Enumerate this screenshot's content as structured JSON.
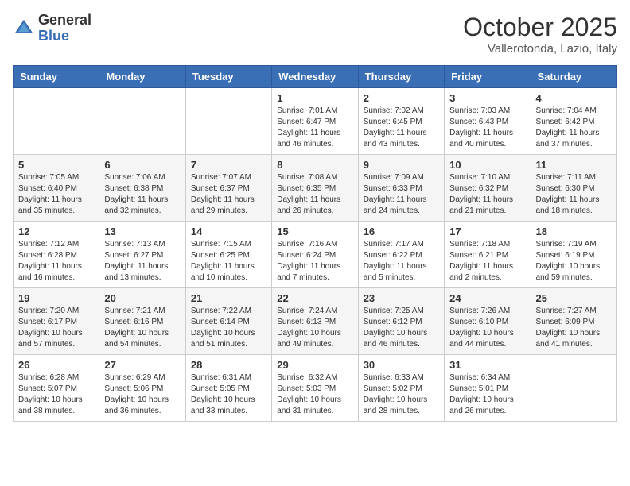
{
  "header": {
    "logo_general": "General",
    "logo_blue": "Blue",
    "month": "October 2025",
    "location": "Vallerotonda, Lazio, Italy"
  },
  "weekdays": [
    "Sunday",
    "Monday",
    "Tuesday",
    "Wednesday",
    "Thursday",
    "Friday",
    "Saturday"
  ],
  "weeks": [
    [
      {
        "day": "",
        "info": ""
      },
      {
        "day": "",
        "info": ""
      },
      {
        "day": "",
        "info": ""
      },
      {
        "day": "1",
        "info": "Sunrise: 7:01 AM\nSunset: 6:47 PM\nDaylight: 11 hours and 46 minutes."
      },
      {
        "day": "2",
        "info": "Sunrise: 7:02 AM\nSunset: 6:45 PM\nDaylight: 11 hours and 43 minutes."
      },
      {
        "day": "3",
        "info": "Sunrise: 7:03 AM\nSunset: 6:43 PM\nDaylight: 11 hours and 40 minutes."
      },
      {
        "day": "4",
        "info": "Sunrise: 7:04 AM\nSunset: 6:42 PM\nDaylight: 11 hours and 37 minutes."
      }
    ],
    [
      {
        "day": "5",
        "info": "Sunrise: 7:05 AM\nSunset: 6:40 PM\nDaylight: 11 hours and 35 minutes."
      },
      {
        "day": "6",
        "info": "Sunrise: 7:06 AM\nSunset: 6:38 PM\nDaylight: 11 hours and 32 minutes."
      },
      {
        "day": "7",
        "info": "Sunrise: 7:07 AM\nSunset: 6:37 PM\nDaylight: 11 hours and 29 minutes."
      },
      {
        "day": "8",
        "info": "Sunrise: 7:08 AM\nSunset: 6:35 PM\nDaylight: 11 hours and 26 minutes."
      },
      {
        "day": "9",
        "info": "Sunrise: 7:09 AM\nSunset: 6:33 PM\nDaylight: 11 hours and 24 minutes."
      },
      {
        "day": "10",
        "info": "Sunrise: 7:10 AM\nSunset: 6:32 PM\nDaylight: 11 hours and 21 minutes."
      },
      {
        "day": "11",
        "info": "Sunrise: 7:11 AM\nSunset: 6:30 PM\nDaylight: 11 hours and 18 minutes."
      }
    ],
    [
      {
        "day": "12",
        "info": "Sunrise: 7:12 AM\nSunset: 6:28 PM\nDaylight: 11 hours and 16 minutes."
      },
      {
        "day": "13",
        "info": "Sunrise: 7:13 AM\nSunset: 6:27 PM\nDaylight: 11 hours and 13 minutes."
      },
      {
        "day": "14",
        "info": "Sunrise: 7:15 AM\nSunset: 6:25 PM\nDaylight: 11 hours and 10 minutes."
      },
      {
        "day": "15",
        "info": "Sunrise: 7:16 AM\nSunset: 6:24 PM\nDaylight: 11 hours and 7 minutes."
      },
      {
        "day": "16",
        "info": "Sunrise: 7:17 AM\nSunset: 6:22 PM\nDaylight: 11 hours and 5 minutes."
      },
      {
        "day": "17",
        "info": "Sunrise: 7:18 AM\nSunset: 6:21 PM\nDaylight: 11 hours and 2 minutes."
      },
      {
        "day": "18",
        "info": "Sunrise: 7:19 AM\nSunset: 6:19 PM\nDaylight: 10 hours and 59 minutes."
      }
    ],
    [
      {
        "day": "19",
        "info": "Sunrise: 7:20 AM\nSunset: 6:17 PM\nDaylight: 10 hours and 57 minutes."
      },
      {
        "day": "20",
        "info": "Sunrise: 7:21 AM\nSunset: 6:16 PM\nDaylight: 10 hours and 54 minutes."
      },
      {
        "day": "21",
        "info": "Sunrise: 7:22 AM\nSunset: 6:14 PM\nDaylight: 10 hours and 51 minutes."
      },
      {
        "day": "22",
        "info": "Sunrise: 7:24 AM\nSunset: 6:13 PM\nDaylight: 10 hours and 49 minutes."
      },
      {
        "day": "23",
        "info": "Sunrise: 7:25 AM\nSunset: 6:12 PM\nDaylight: 10 hours and 46 minutes."
      },
      {
        "day": "24",
        "info": "Sunrise: 7:26 AM\nSunset: 6:10 PM\nDaylight: 10 hours and 44 minutes."
      },
      {
        "day": "25",
        "info": "Sunrise: 7:27 AM\nSunset: 6:09 PM\nDaylight: 10 hours and 41 minutes."
      }
    ],
    [
      {
        "day": "26",
        "info": "Sunrise: 6:28 AM\nSunset: 5:07 PM\nDaylight: 10 hours and 38 minutes."
      },
      {
        "day": "27",
        "info": "Sunrise: 6:29 AM\nSunset: 5:06 PM\nDaylight: 10 hours and 36 minutes."
      },
      {
        "day": "28",
        "info": "Sunrise: 6:31 AM\nSunset: 5:05 PM\nDaylight: 10 hours and 33 minutes."
      },
      {
        "day": "29",
        "info": "Sunrise: 6:32 AM\nSunset: 5:03 PM\nDaylight: 10 hours and 31 minutes."
      },
      {
        "day": "30",
        "info": "Sunrise: 6:33 AM\nSunset: 5:02 PM\nDaylight: 10 hours and 28 minutes."
      },
      {
        "day": "31",
        "info": "Sunrise: 6:34 AM\nSunset: 5:01 PM\nDaylight: 10 hours and 26 minutes."
      },
      {
        "day": "",
        "info": ""
      }
    ]
  ]
}
